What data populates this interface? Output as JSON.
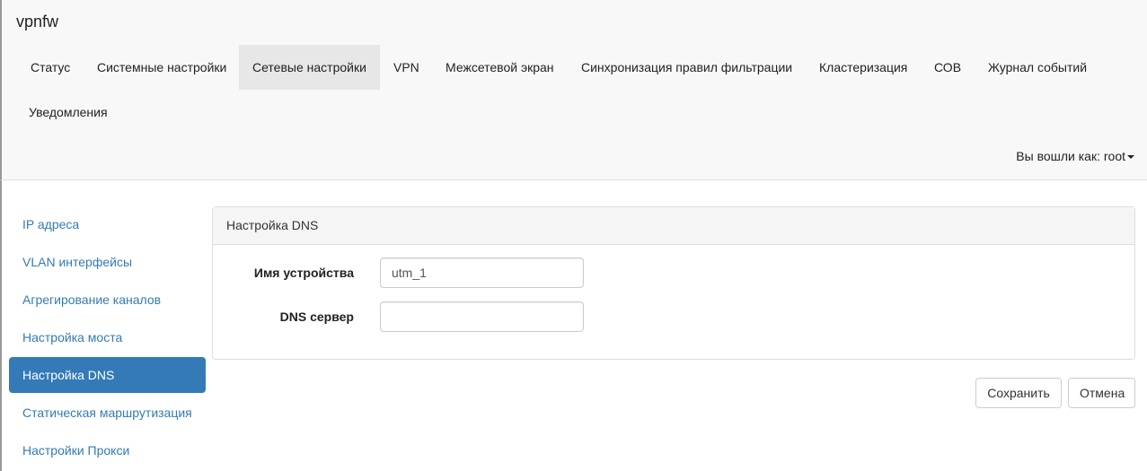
{
  "brand": "vpnfw",
  "nav": [
    "Статус",
    "Системные настройки",
    "Сетевые настройки",
    "VPN",
    "Межсетевой экран",
    "Синхронизация правил фильтрации",
    "Кластеризация",
    "СОВ",
    "Журнал событий",
    "Уведомления"
  ],
  "user": "Вы вошли как: root",
  "sidebar": [
    "IP адреса",
    "VLAN интерфейсы",
    "Агрегирование каналов",
    "Настройка моста",
    "Настройка DNS",
    "Статическая маршрутизация",
    "Настройки Прокси"
  ],
  "panel": {
    "title": "Настройка DNS",
    "hostname_label": "Имя устройства",
    "hostname_value": "utm_1",
    "dns_label": "DNS сервер",
    "dns_value": ""
  },
  "buttons": {
    "save": "Сохранить",
    "cancel": "Отмена"
  }
}
